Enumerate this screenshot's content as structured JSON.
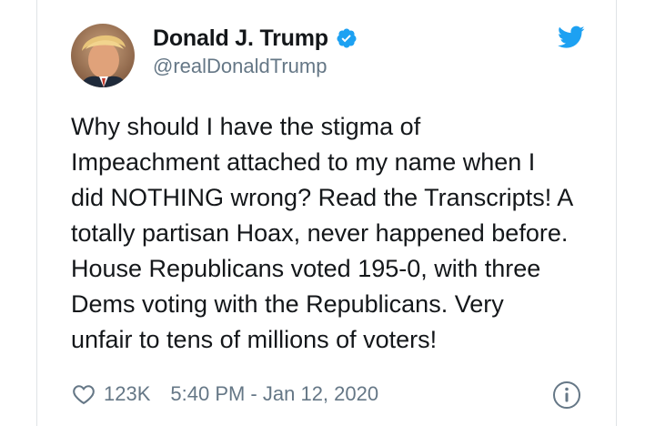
{
  "author": {
    "display_name": "Donald J. Trump",
    "handle": "@realDonaldTrump",
    "verified": true
  },
  "tweet": {
    "text": "Why should I have the stigma of\nImpeachment attached to my name when I\ndid NOTHING wrong? Read the Transcripts! A\ntotally partisan Hoax, never happened before.\nHouse Republicans voted 195-0, with three\nDems voting with the Republicans. Very\nunfair to tens of millions of voters!"
  },
  "footer": {
    "like_count": "123K",
    "timestamp": "5:40 PM - Jan 12, 2020"
  },
  "icons": {
    "brand": "twitter-bird-icon",
    "verified": "verified-badge-icon",
    "like": "heart-icon",
    "info": "info-icon"
  },
  "colors": {
    "brand_blue": "#1da1f2",
    "text": "#14171a",
    "secondary_text": "#657786",
    "border": "#dfe3e6"
  }
}
